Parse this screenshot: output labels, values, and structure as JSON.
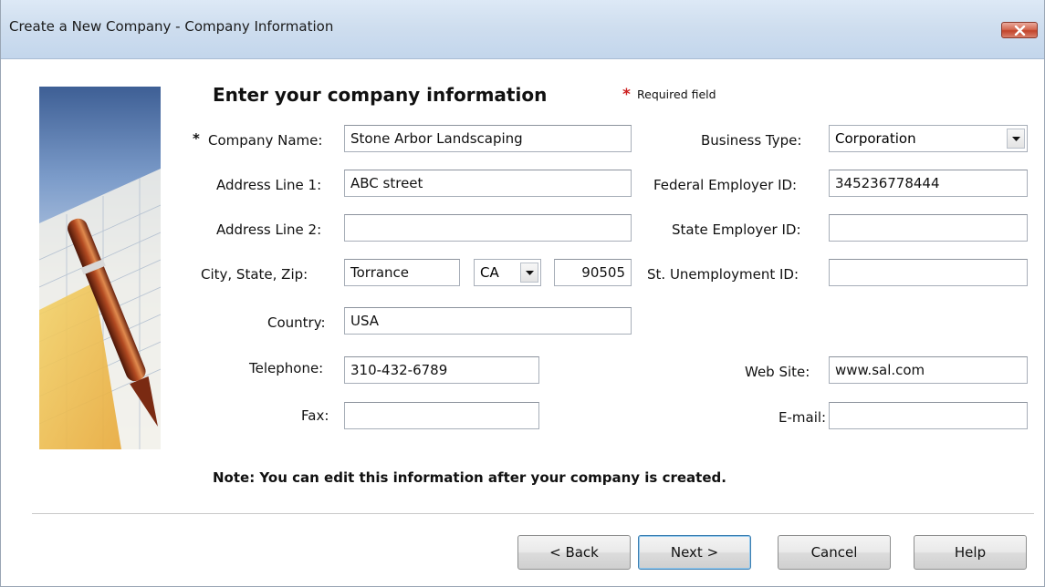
{
  "window": {
    "title": "Create a New Company - Company Information",
    "close_icon": "close-x-icon"
  },
  "heading": "Enter your company information",
  "required_star": "*",
  "required_label": "Required field",
  "fields": {
    "company_name": {
      "label": "Company Name:",
      "value": "Stone Arbor Landscaping"
    },
    "address1": {
      "label": "Address Line 1:",
      "value": "ABC street"
    },
    "address2": {
      "label": "Address Line 2:",
      "value": ""
    },
    "city_state_zip": {
      "label": "City, State, Zip:",
      "city": "Torrance",
      "state": "CA",
      "zip": "90505"
    },
    "country": {
      "label": "Country:",
      "value": "USA"
    },
    "telephone": {
      "label": "Telephone:",
      "value": "310-432-6789"
    },
    "fax": {
      "label": "Fax:",
      "value": ""
    },
    "business_type": {
      "label": "Business Type:",
      "value": "Corporation"
    },
    "federal_id": {
      "label": "Federal Employer ID:",
      "value": "345236778444"
    },
    "state_id": {
      "label": "State Employer ID:",
      "value": ""
    },
    "unemployment_id": {
      "label": "St. Unemployment ID:",
      "value": ""
    },
    "website": {
      "label": "Web Site:",
      "value": "www.sal.com"
    },
    "email": {
      "label": "E-mail:",
      "value": ""
    }
  },
  "note": "Note:  You can edit this information after your company is created.",
  "buttons": {
    "back": "< Back",
    "next": "Next >",
    "cancel": "Cancel",
    "help": "Help"
  },
  "colors": {
    "required": "#cc1f1f",
    "title_bar": "#cfdeef",
    "close_button": "#c2432a"
  }
}
